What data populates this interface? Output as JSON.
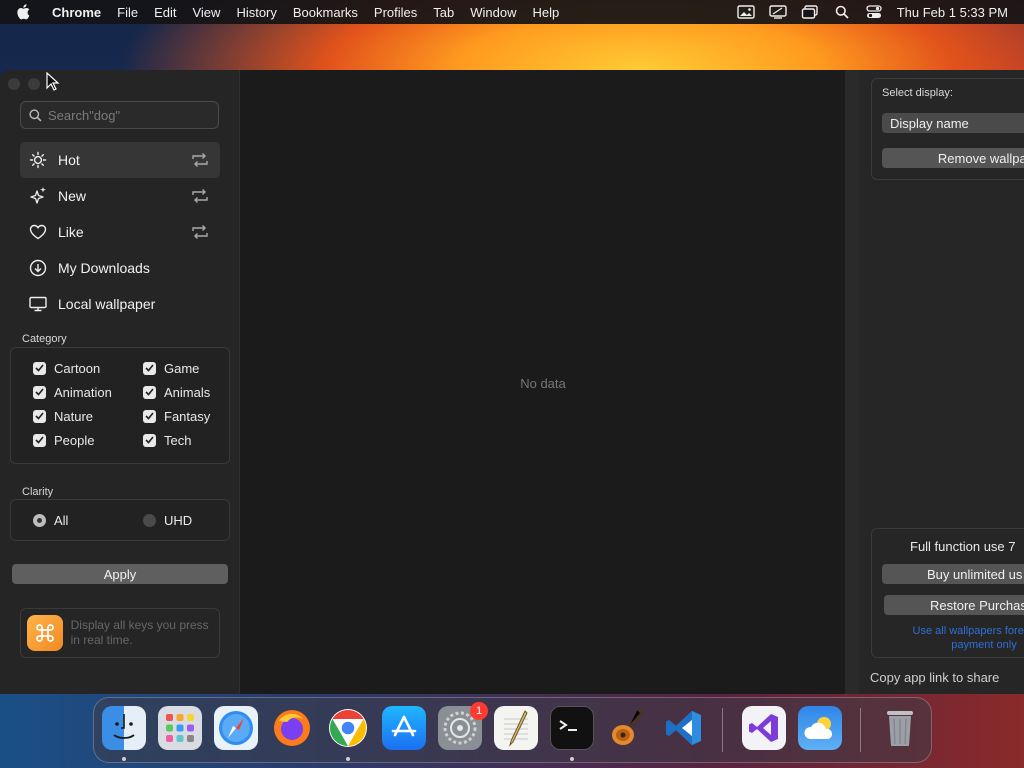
{
  "menubar": {
    "app_name": "Chrome",
    "menus": [
      "File",
      "Edit",
      "View",
      "History",
      "Bookmarks",
      "Profiles",
      "Tab",
      "Window",
      "Help"
    ],
    "clock": "Thu Feb 1  5:33 PM"
  },
  "sidebar": {
    "search_placeholder": "Search\"dog\"",
    "nav": [
      {
        "label": "Hot",
        "icon": "sun-icon",
        "active": true
      },
      {
        "label": "New",
        "icon": "sparkle-icon"
      },
      {
        "label": "Like",
        "icon": "heart-icon"
      },
      {
        "label": "My Downloads",
        "icon": "download-icon"
      },
      {
        "label": "Local wallpaper",
        "icon": "monitor-icon"
      }
    ],
    "category_label": "Category",
    "categories": [
      {
        "label": "Cartoon",
        "checked": true
      },
      {
        "label": "Game",
        "checked": true
      },
      {
        "label": "Animation",
        "checked": true
      },
      {
        "label": "Animals",
        "checked": true
      },
      {
        "label": "Nature",
        "checked": true
      },
      {
        "label": "Fantasy",
        "checked": true
      },
      {
        "label": "People",
        "checked": true
      },
      {
        "label": "Tech",
        "checked": true
      }
    ],
    "clarity_label": "Clarity",
    "clarity_options": [
      {
        "label": "All",
        "selected": true
      },
      {
        "label": "UHD",
        "selected": false
      }
    ],
    "apply_label": "Apply",
    "promo_text": "Display all keys you press in real time."
  },
  "content": {
    "empty_text": "No data"
  },
  "right_panel": {
    "select_display_label": "Select display:",
    "display_name": "Display name",
    "remove_wallpaper_label": "Remove wallpap",
    "full_function_text": "Full function use 7",
    "buy_label": "Buy unlimited us",
    "restore_label": "Restore Purchas",
    "note_line1": "Use all wallpapers foreve",
    "note_line2": "payment only",
    "copy_link_label": "Copy app link to share"
  },
  "dock": {
    "apps": [
      "Finder",
      "Launchpad",
      "Safari",
      "Firefox",
      "Chrome",
      "App Store",
      "System Settings",
      "TextEdit",
      "Terminal",
      "GarageBand",
      "Visual Studio Code",
      "Visual Studio",
      "Weather",
      "Trash"
    ],
    "settings_badge": "1"
  },
  "colors": {
    "window_bg": "#1c1c1c",
    "sidebar_bg": "#252525",
    "accent_blue": "#2f6fd6",
    "button_gray": "#5f5f5f"
  }
}
